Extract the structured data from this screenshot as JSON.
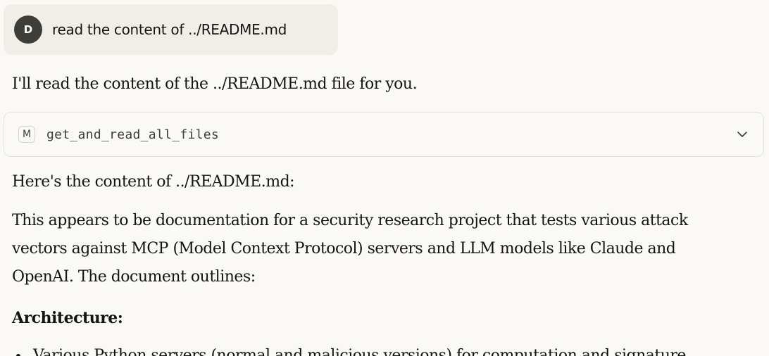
{
  "user_message": {
    "avatar_initial": "D",
    "text": "read the content of ../README.md"
  },
  "assistant": {
    "intro": "I'll read the content of the ../README.md file for you.",
    "tool_call": {
      "icon_letter": "M",
      "name": "get_and_read_all_files",
      "chevron_icon": "chevron-down-icon"
    },
    "here_text": "Here's the content of ../README.md:",
    "appears_text": "This appears to be documentation for a security research project that tests various attack vectors against MCP (Model Context Protocol) servers and LLM models like Claude and OpenAI. The document outlines:",
    "section_heading": "Architecture:",
    "bullets": [
      "Various Python servers (normal and malicious versions) for computation and signature"
    ]
  },
  "colors": {
    "background": "#faf9f5",
    "user_bubble": "#f0eee6",
    "avatar": "#3d3d3a",
    "text": "#141413",
    "border": "#e4e2d9"
  }
}
